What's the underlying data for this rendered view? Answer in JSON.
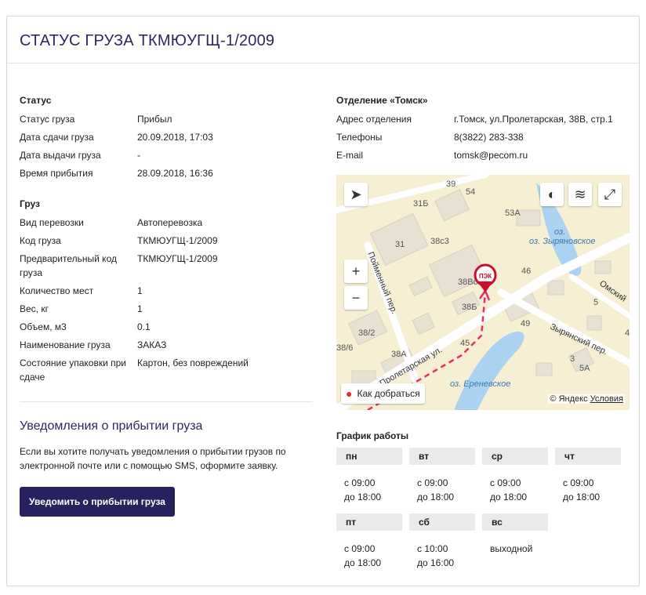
{
  "title": "СТАТУС ГРУЗА ТКМЮУГЩ-1/2009",
  "status": {
    "heading": "Статус",
    "rows": [
      {
        "k": "Статус груза",
        "v": "Прибыл"
      },
      {
        "k": "Дата сдачи груза",
        "v": "20.09.2018, 17:03"
      },
      {
        "k": "Дата выдачи груза",
        "v": "-"
      },
      {
        "k": "Время прибытия",
        "v": "28.09.2018, 16:36"
      }
    ]
  },
  "cargo": {
    "heading": "Груз",
    "rows": [
      {
        "k": "Вид перевозки",
        "v": "Автоперевозка"
      },
      {
        "k": "Код груза",
        "v": "ТКМЮУГЩ-1/2009"
      },
      {
        "k": "Предварительный код груза",
        "v": "ТКМЮУГЩ-1/2009"
      },
      {
        "k": "Количество мест",
        "v": "1"
      },
      {
        "k": "Вес, кг",
        "v": "1"
      },
      {
        "k": "Объем, м3",
        "v": "0.1"
      },
      {
        "k": "Наименование груза",
        "v": "ЗАКАЗ"
      },
      {
        "k": "Состояние упаковки при сдаче",
        "v": "Картон, без повреждений"
      }
    ]
  },
  "notify": {
    "title": "Уведомления о прибытии груза",
    "text": "Если вы хотите получать уведомления о прибытии грузов по электронной почте или с помощью SMS, оформите заявку.",
    "button": "Уведомить о прибытии груза"
  },
  "office": {
    "heading": "Отделение «Томск»",
    "rows": [
      {
        "k": "Адрес отделения",
        "v": "г.Томск, ул.Пролетарская, 38В, стр.1"
      },
      {
        "k": "Телефоны",
        "v": "8(3822) 283-338"
      },
      {
        "k": "E-mail",
        "v": "tomsk@pecom.ru"
      }
    ]
  },
  "map": {
    "route_label": "Как добраться",
    "copyright": "© Яндекс",
    "terms": "Условия",
    "marker_label": "ПЭК",
    "street_labels": [
      "Пойменный пер.",
      "Пролетарская ул.",
      "Зырянский пер.",
      "Омский"
    ],
    "water_labels": [
      "оз. Зыряновское",
      "оз. Ереневское"
    ],
    "oz_prefix": "оз.",
    "building_numbers": [
      "39",
      "54",
      "31Б",
      "53А",
      "31",
      "38с3",
      "46",
      "38Вс",
      "38Б",
      "49",
      "38/2",
      "45",
      "38/6",
      "38А",
      "3",
      "5",
      "5А",
      "4"
    ],
    "colors": {
      "land": "#f7efd3",
      "water": "#a9d3f0",
      "building": "#e6e1d3",
      "road": "#ffffff",
      "route": "#e0306a"
    }
  },
  "schedule": {
    "heading": "График работы",
    "days": [
      {
        "day": "пн",
        "line1": "с 09:00",
        "line2": "до 18:00"
      },
      {
        "day": "вт",
        "line1": "с 09:00",
        "line2": "до 18:00"
      },
      {
        "day": "ср",
        "line1": "с 09:00",
        "line2": "до 18:00"
      },
      {
        "day": "чт",
        "line1": "с 09:00",
        "line2": "до 18:00"
      },
      {
        "day": "пт",
        "line1": "с 09:00",
        "line2": "до 18:00"
      },
      {
        "day": "сб",
        "line1": "с 10:00",
        "line2": "до 16:00"
      },
      {
        "day": "вс",
        "line1": "выходной",
        "line2": ""
      }
    ]
  },
  "theme": {
    "accent": "#27215e",
    "title_color": "#2a2960"
  }
}
